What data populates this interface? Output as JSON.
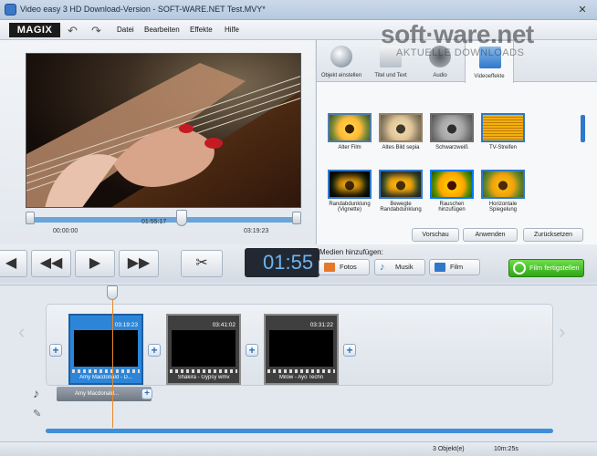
{
  "window": {
    "title": "Video easy 3 HD Download-Version - SOFT-WARE.NET Test.MVY*",
    "close": "✕"
  },
  "menu": {
    "logo": "MAGIX",
    "items": [
      "Datei",
      "Bearbeiten",
      "Effekte",
      "Hilfe"
    ]
  },
  "preview": {
    "time_start": "00:00:00",
    "time_current": "01:55:17",
    "time_end": "03:19:23"
  },
  "transport": {
    "timecode": "01:55"
  },
  "tabs": [
    {
      "label": "Objekt einstellen"
    },
    {
      "label": "Titel und Text"
    },
    {
      "label": "Audio"
    },
    {
      "label": "Videoeffekte"
    }
  ],
  "effects": [
    {
      "label": "Alter Film"
    },
    {
      "label": "Altes Bild sepia"
    },
    {
      "label": "Schwarzweiß"
    },
    {
      "label": "TV-Streifen"
    },
    {
      "label": "Randabdunklung (Vignette)"
    },
    {
      "label": "Bewegte Randabdunklung"
    },
    {
      "label": "Rauschen hinzufügen"
    },
    {
      "label": "Horizontale Spiegelung"
    }
  ],
  "effect_buttons": {
    "preview": "Vorschau",
    "apply": "Anwenden",
    "reset": "Zurücksetzen"
  },
  "media": {
    "label": "Medien hinzufügen:",
    "photos": "Fotos",
    "music": "Musik",
    "film": "Film",
    "finish": "Film fertigstellen"
  },
  "clips": [
    {
      "duration": "03:19:23",
      "name": "Amy Macdonald - D..."
    },
    {
      "duration": "03:41:02",
      "name": "Shakira - Gypsy wmv"
    },
    {
      "duration": "03:31:22",
      "name": "Milow - Ayo Techn"
    }
  ],
  "audio_track": {
    "name": "Amy Macdonald..."
  },
  "status": {
    "objects": "3 Objekt(e)",
    "length": "10m:25s"
  },
  "watermark": {
    "line1": "soft·ware.net",
    "line2": "AKTUELLE DOWNLOADS"
  },
  "colors": {
    "accent": "#2f78c9",
    "finish_green": "#3fb41f",
    "timecode": "#6fb4ee"
  }
}
